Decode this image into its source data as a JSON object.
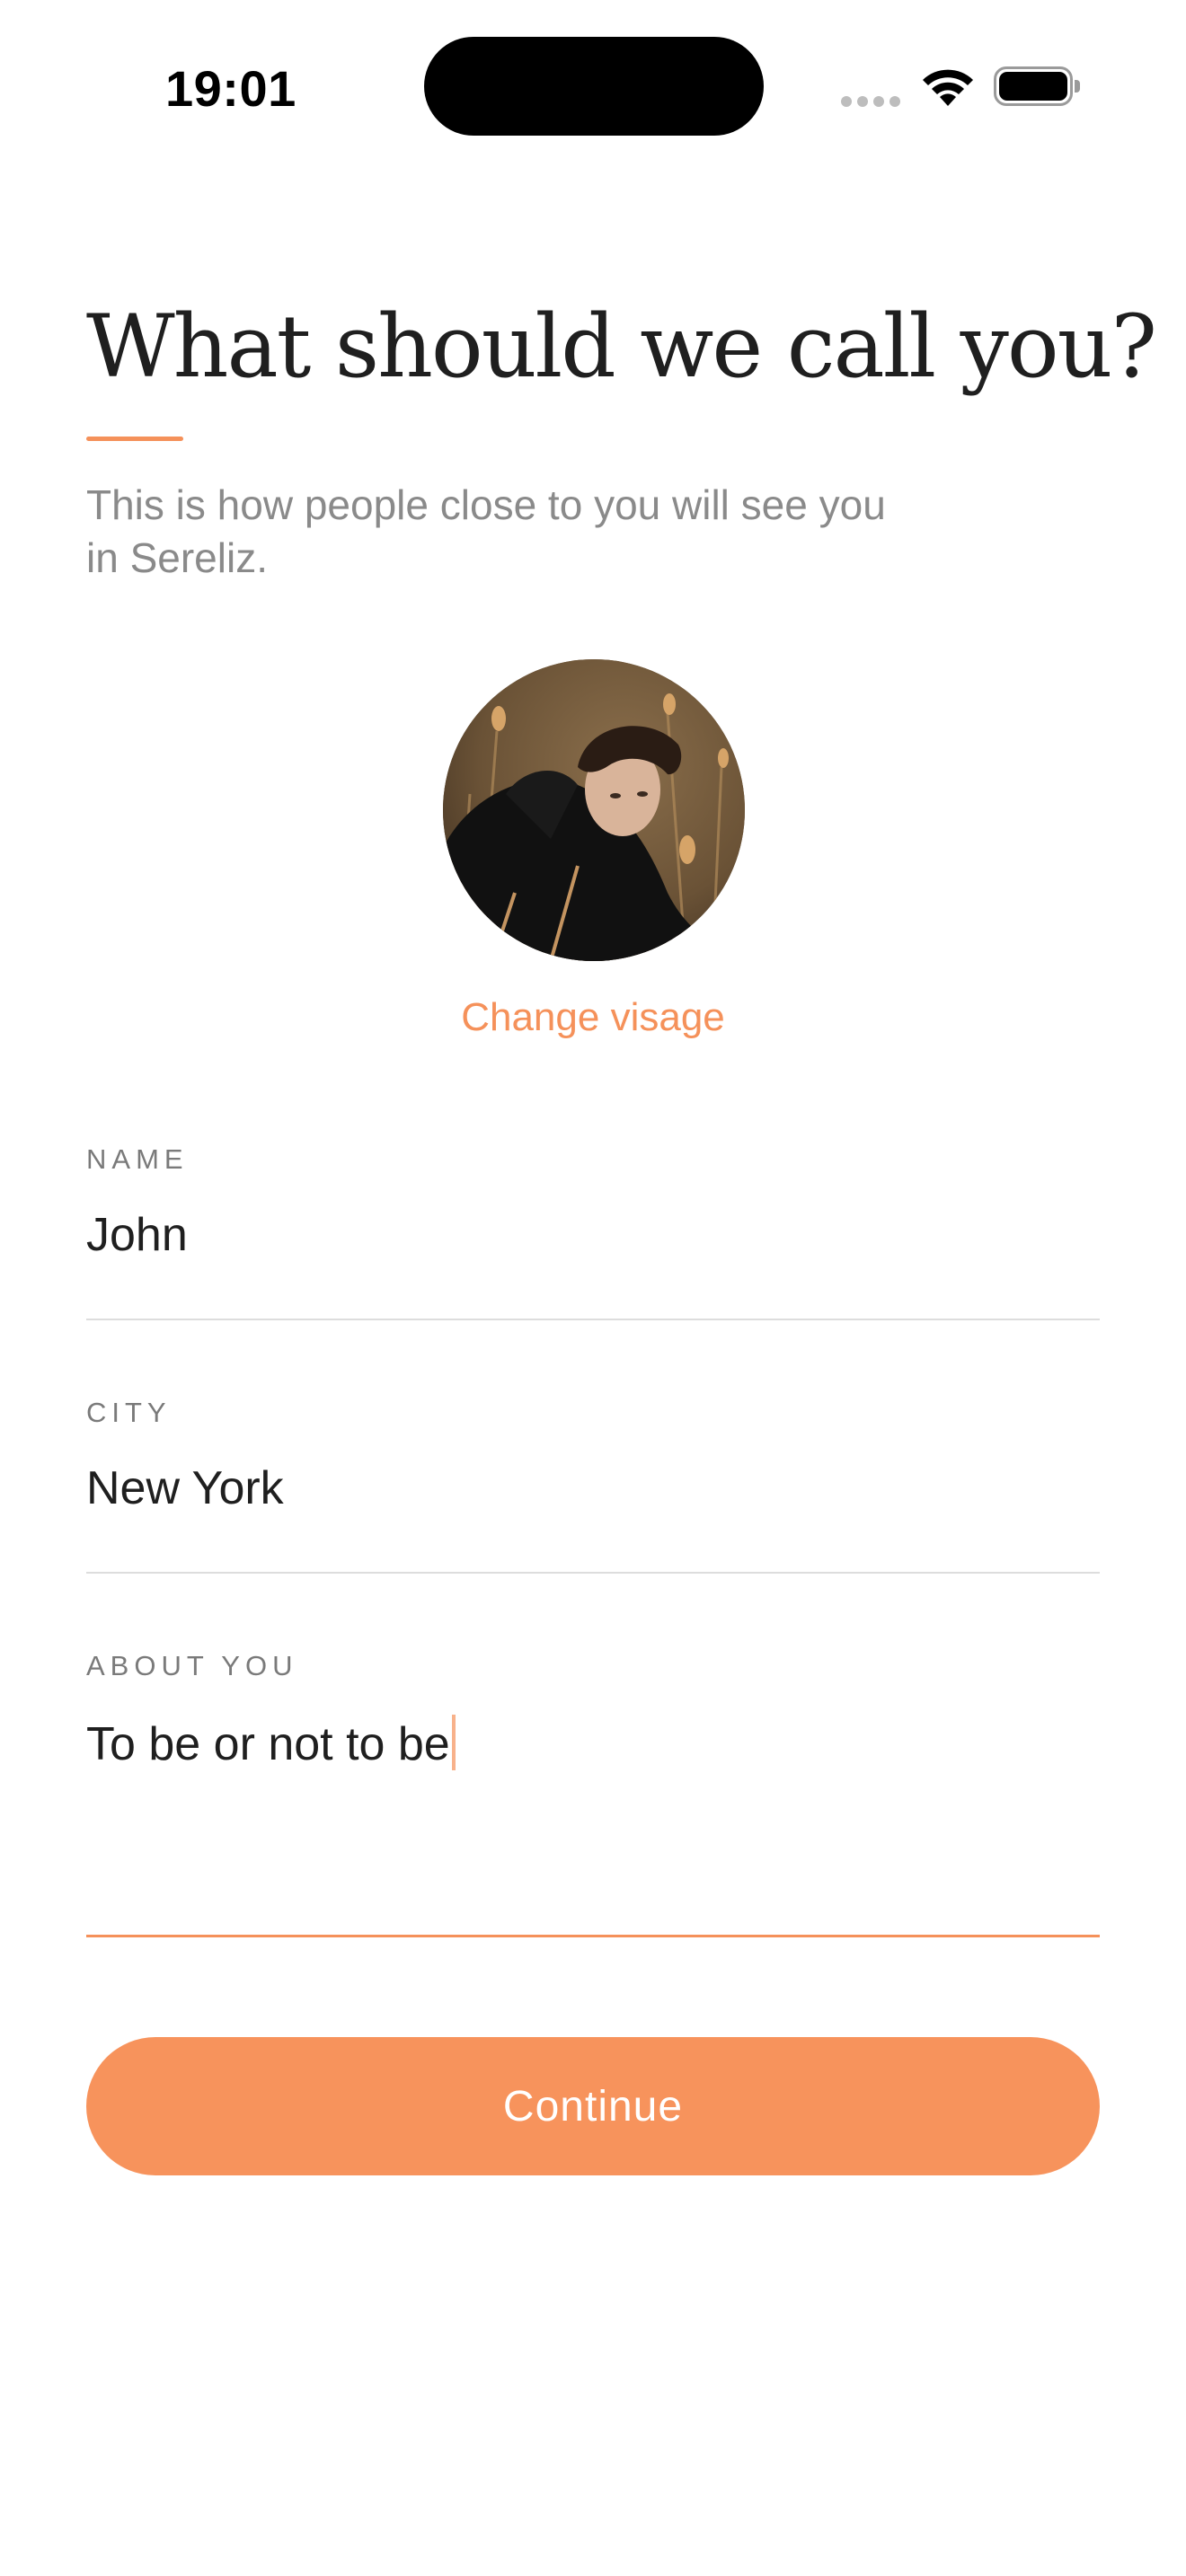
{
  "status_bar": {
    "time": "19:01"
  },
  "header": {
    "title": "What should we call you?",
    "subtitle_line1": "This is how people close to you will see you",
    "subtitle_line2": "in Sereliz."
  },
  "profile": {
    "change_photo_label": "Change visage"
  },
  "form": {
    "name": {
      "label": "NAME",
      "value": "John"
    },
    "city": {
      "label": "CITY",
      "value": "New York"
    },
    "about": {
      "label": "ABOUT YOU",
      "value": "To be or not to be"
    }
  },
  "actions": {
    "continue_label": "Continue"
  },
  "colors": {
    "accent": "#f5915a",
    "button": "#f7935c",
    "text_primary": "#1f1f1f",
    "text_secondary": "#8a8a8a",
    "divider": "#dddddd"
  }
}
